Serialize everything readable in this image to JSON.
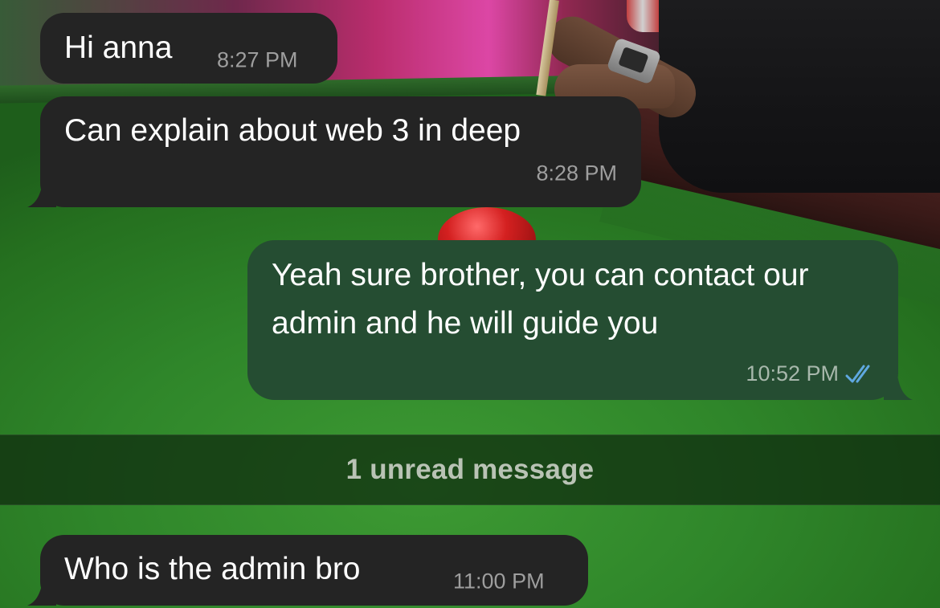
{
  "unread_divider": {
    "label": "1 unread message"
  },
  "messages": [
    {
      "direction": "incoming",
      "text": "Hi anna",
      "time": "8:27 PM"
    },
    {
      "direction": "incoming",
      "text": "Can explain about web 3 in deep",
      "time": "8:28 PM"
    },
    {
      "direction": "outgoing",
      "text": "Yeah sure brother, you can contact our admin and he will guide you",
      "time": "10:52 PM",
      "status_icon": "double-check-read-icon"
    },
    {
      "direction": "incoming",
      "text": "Who is the admin bro",
      "time": "11:00 PM"
    }
  ],
  "colors": {
    "incoming_bubble": "#242424",
    "outgoing_bubble": "#254d32",
    "read_ticks": "#5fa8e0",
    "timestamp": "#9e9e9e"
  }
}
